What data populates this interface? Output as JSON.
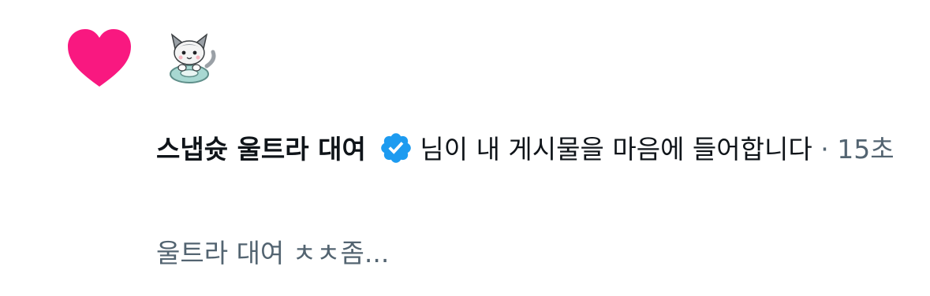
{
  "notification": {
    "username": "스냅슛 울트라 대여",
    "action_text": "님이 내 게시물을 마음에 들어합니다",
    "separator": " · ",
    "timestamp": "15초",
    "post_preview": "울트라 대여 ㅊㅊ좀...",
    "icons": {
      "type_icon": "heart-icon",
      "badge_icon": "verified-badge-icon"
    },
    "colors": {
      "heart": "#f91880",
      "verified": "#1d9bf0",
      "secondary_text": "#536471"
    }
  }
}
